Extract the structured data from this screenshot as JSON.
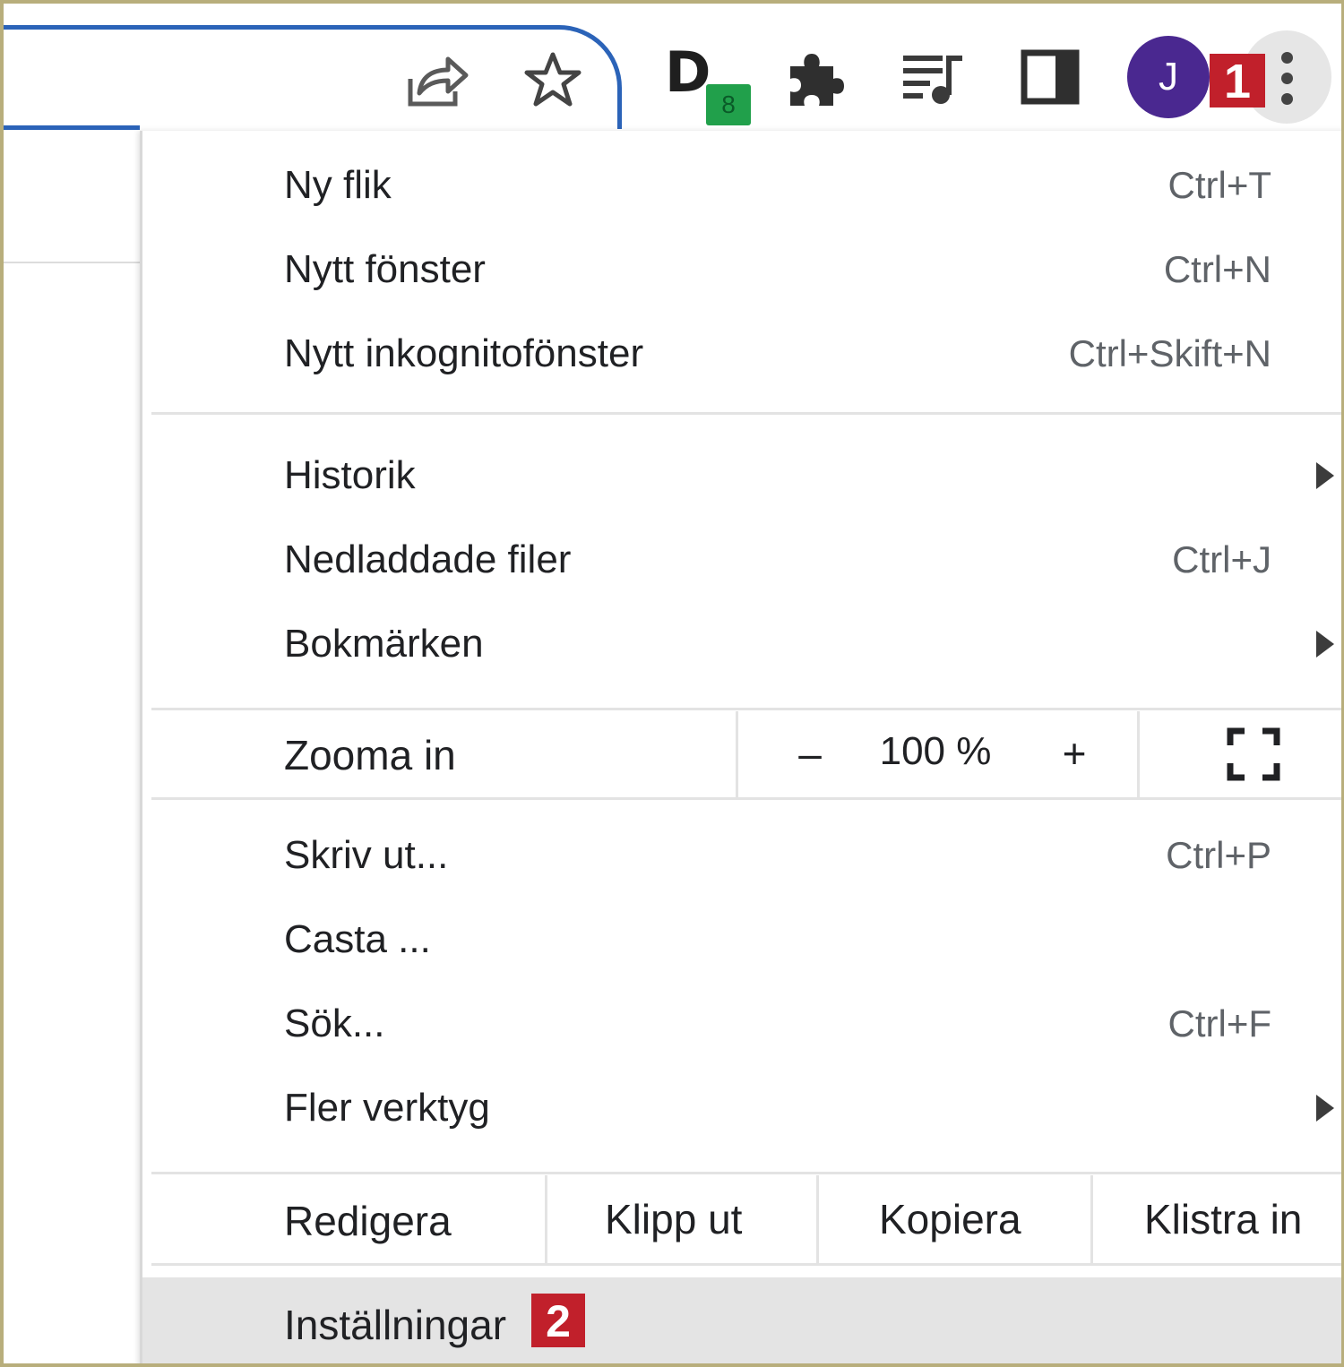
{
  "toolbar": {
    "avatar_initial": "J",
    "extension_letter": "D",
    "extension_badge": "8",
    "step1_badge": "1"
  },
  "menu": {
    "group1": [
      {
        "label": "Ny flik",
        "shortcut": "Ctrl+T"
      },
      {
        "label": "Nytt fönster",
        "shortcut": "Ctrl+N"
      },
      {
        "label": "Nytt inkognitofönster",
        "shortcut": "Ctrl+Skift+N"
      }
    ],
    "group2": [
      {
        "label": "Historik",
        "shortcut": ""
      },
      {
        "label": "Nedladdade filer",
        "shortcut": "Ctrl+J"
      },
      {
        "label": "Bokmärken",
        "shortcut": ""
      }
    ],
    "zoom": {
      "label": "Zooma in",
      "minus": "–",
      "value": "100 %",
      "plus": "+"
    },
    "group3": [
      {
        "label": "Skriv ut...",
        "shortcut": "Ctrl+P"
      },
      {
        "label": "Casta ...",
        "shortcut": ""
      },
      {
        "label": "Sök...",
        "shortcut": "Ctrl+F"
      },
      {
        "label": "Fler verktyg",
        "shortcut": ""
      }
    ],
    "edit": {
      "label": "Redigera",
      "cut": "Klipp ut",
      "copy": "Kopiera",
      "paste": "Klistra in"
    },
    "settings": {
      "label": "Inställningar",
      "step2_badge": "2"
    }
  },
  "colors": {
    "accent_blue": "#2b63b8",
    "step_badge_red": "#c1202b",
    "avatar_purple": "#4a2890",
    "extension_badge_green": "#21a04b",
    "highlight_gray": "#e4e4e4"
  }
}
